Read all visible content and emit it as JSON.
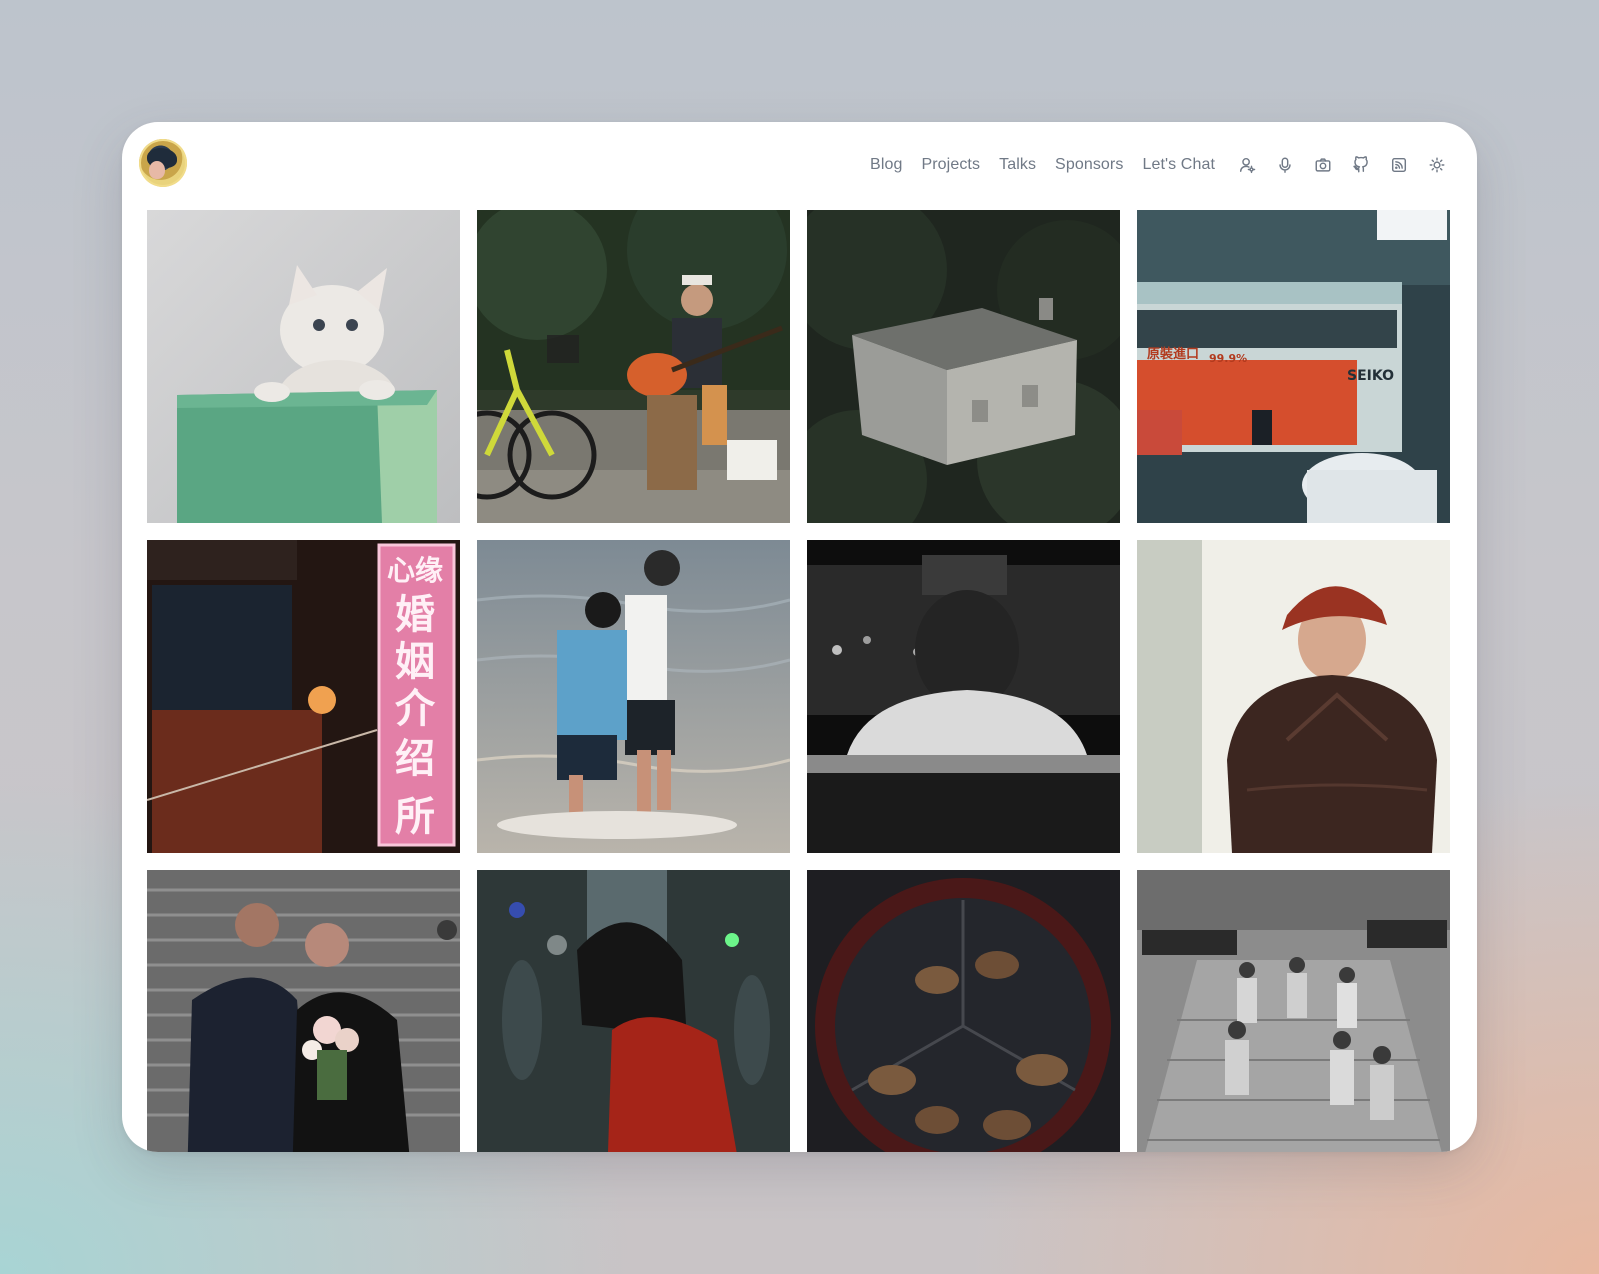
{
  "site": {
    "avatar_icon": "avatar-icon"
  },
  "nav": {
    "links": [
      "Blog",
      "Projects",
      "Talks",
      "Sponsors",
      "Let's Chat"
    ],
    "icons": [
      "person-icon",
      "microphone-icon",
      "camera-icon",
      "github-icon",
      "rss-icon",
      "sun-icon"
    ]
  },
  "gallery": {
    "photos": [
      {
        "subject": "kitten-in-box"
      },
      {
        "subject": "street-guitarist"
      },
      {
        "subject": "old-house-in-trees"
      },
      {
        "subject": "double-decker-bus"
      },
      {
        "subject": "neon-sign-alley"
      },
      {
        "subject": "kids-playing-in-water"
      },
      {
        "subject": "passenger-in-car"
      },
      {
        "subject": "elderly-woman-red-hat"
      },
      {
        "subject": "couple-on-steps"
      },
      {
        "subject": "girl-in-red-jacket"
      },
      {
        "subject": "pine-cones-display"
      },
      {
        "subject": "subway-stairs-crowd"
      }
    ],
    "sign_text": [
      "心缘",
      "婚",
      "姻",
      "介",
      "绍",
      "所"
    ],
    "bus_text": [
      "原裝進口",
      "99.9%",
      "SEIKO"
    ]
  },
  "colors": {
    "nav_text": "#707986",
    "card_bg": "#ffffff"
  }
}
